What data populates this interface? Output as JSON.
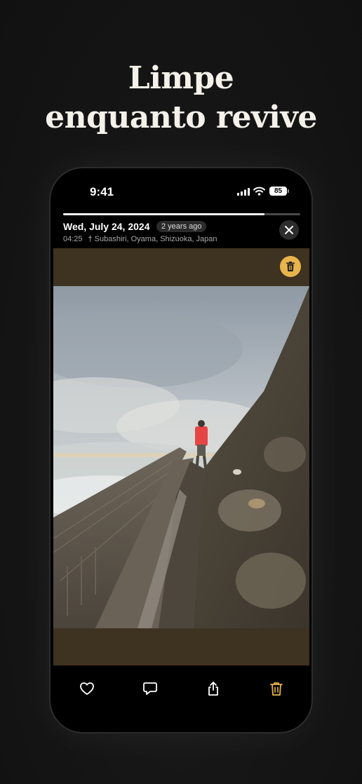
{
  "headline": {
    "line1": "Limpe",
    "line2": "enquanto revive"
  },
  "status_bar": {
    "time": "9:41",
    "battery_level": "85",
    "icons": [
      "cellular-signal-icon",
      "wifi-icon",
      "battery-icon"
    ]
  },
  "viewer": {
    "story_progress": 0.85,
    "date": "Wed, July 24, 2024",
    "age_badge": "2 years ago",
    "time": "04:25",
    "location": "Subashiri, Oyama, Shizuoka, Japan",
    "close_icon": "close-icon",
    "delete_badge_icon": "trash-icon"
  },
  "toolbar": {
    "buttons": [
      {
        "name": "favorite-button",
        "icon": "heart-icon"
      },
      {
        "name": "comment-button",
        "icon": "speech-bubble-icon"
      },
      {
        "name": "share-button",
        "icon": "share-icon"
      },
      {
        "name": "delete-button",
        "icon": "trash-icon"
      }
    ]
  },
  "colors": {
    "background": "#141414",
    "headline": "#f4f1ea",
    "accent": "#e9b44c",
    "photo_matte": "#3e3220"
  }
}
